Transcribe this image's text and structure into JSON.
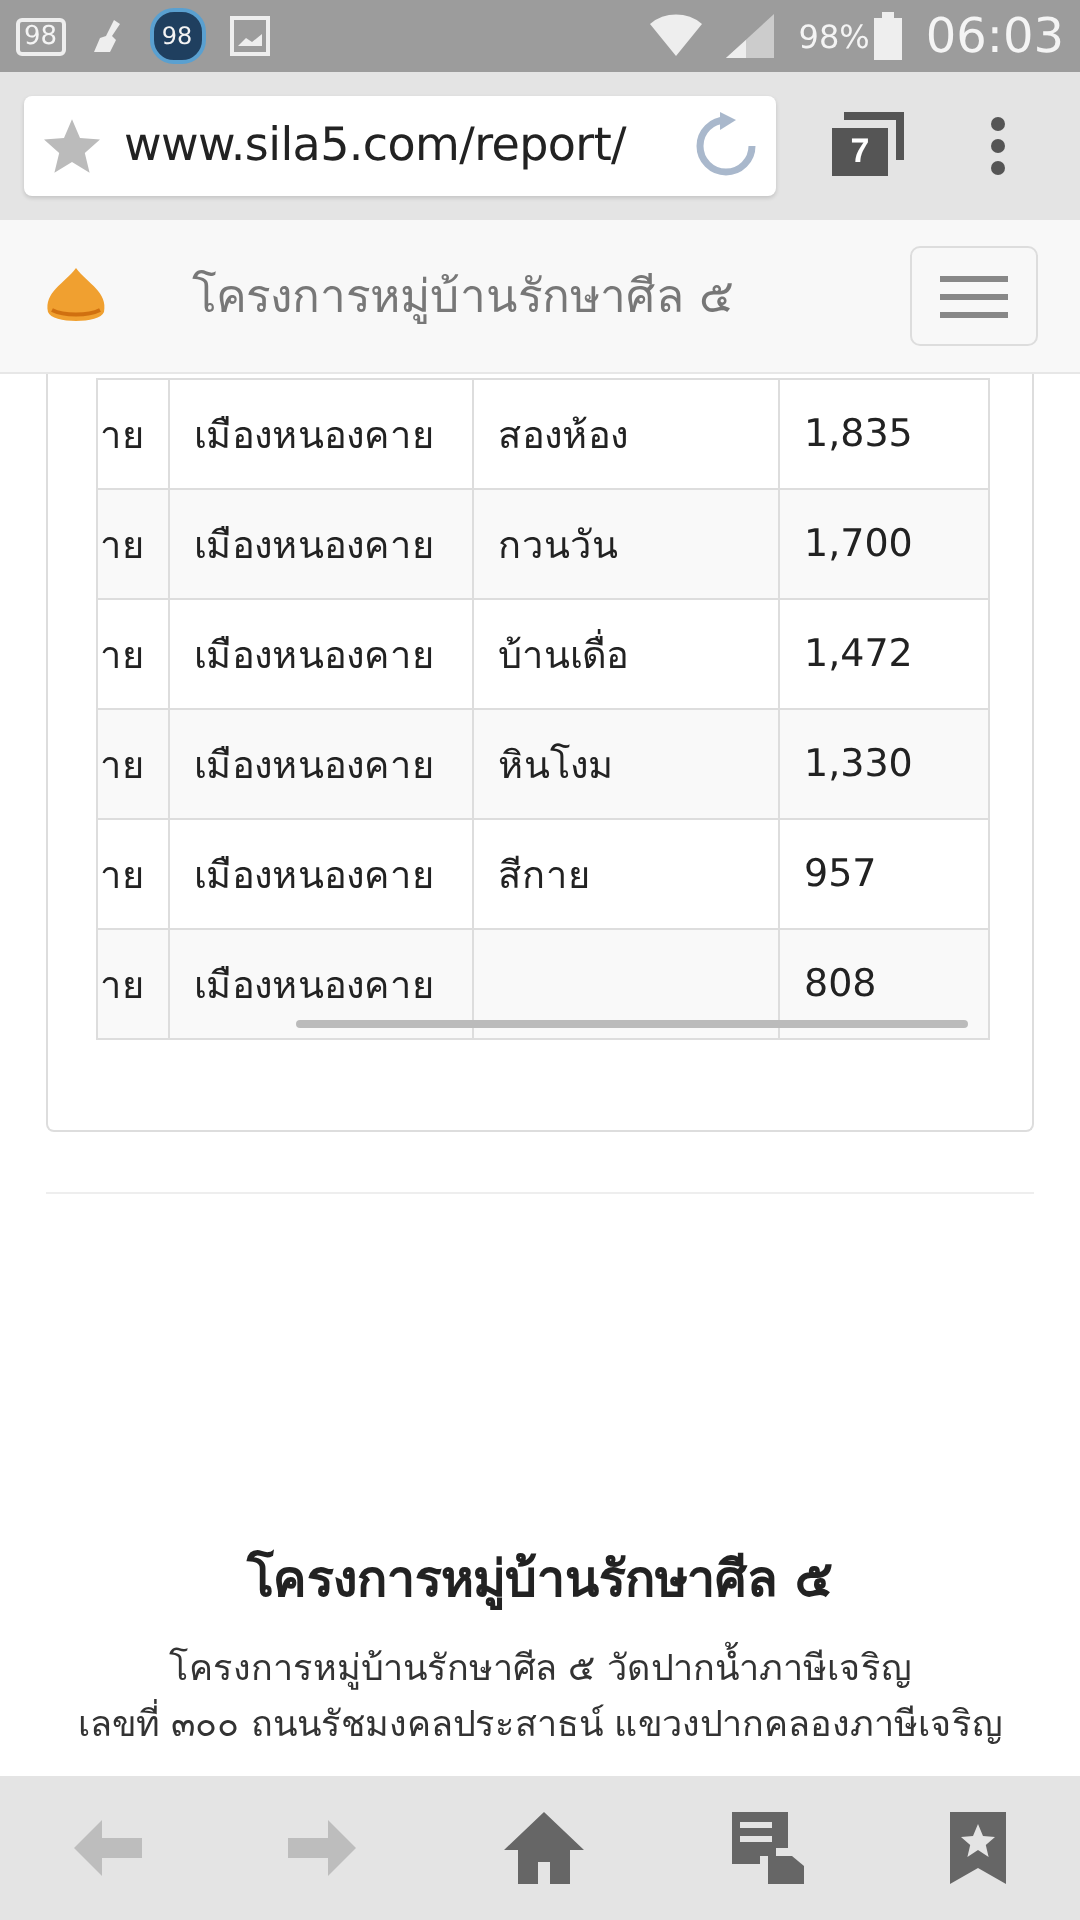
{
  "status_bar": {
    "notifications": [
      {
        "kind": "badge",
        "text": "98"
      },
      {
        "kind": "broom"
      },
      {
        "kind": "circle",
        "text": "98"
      },
      {
        "kind": "image"
      }
    ],
    "battery_text": "98%",
    "time": "06:03"
  },
  "browser": {
    "url": "www.sila5.com/report/",
    "tab_count": "7"
  },
  "site_header": {
    "title": "โครงการหมู่บ้านรักษาศีล ๕"
  },
  "table": {
    "rows": [
      {
        "column_1": "าย",
        "column_2": "เมืองหนองคาย",
        "column_3": "สองห้อง",
        "column_4": "1,835"
      },
      {
        "column_1": "าย",
        "column_2": "เมืองหนองคาย",
        "column_3": "กวนวัน",
        "column_4": "1,700"
      },
      {
        "column_1": "าย",
        "column_2": "เมืองหนองคาย",
        "column_3": "บ้านเดื่อ",
        "column_4": "1,472"
      },
      {
        "column_1": "าย",
        "column_2": "เมืองหนองคาย",
        "column_3": "หินโงม",
        "column_4": "1,330"
      },
      {
        "column_1": "าย",
        "column_2": "เมืองหนองคาย",
        "column_3": "สีกาย",
        "column_4": "957"
      },
      {
        "column_1": "าย",
        "column_2": "เมืองหนองคาย",
        "column_4": "808"
      }
    ]
  },
  "footer": {
    "title": "โครงการหมู่บ้านรักษาศีล ๕",
    "lines": [
      "โครงการหมู่บ้านรักษาศีล ๕ วัดปากน้ำภาษีเจริญ",
      "เลขที่ ๓๐๐ ถนนรัชมงคลประสาธน์ แขวงปากคลองภาษีเจริญ"
    ]
  },
  "bottom_bar": [
    {
      "kind": "back",
      "disabled": true
    },
    {
      "kind": "forward",
      "disabled": true
    },
    {
      "kind": "home",
      "disabled": false
    },
    {
      "kind": "reader",
      "disabled": false
    },
    {
      "kind": "bookmarks",
      "disabled": false
    }
  ]
}
